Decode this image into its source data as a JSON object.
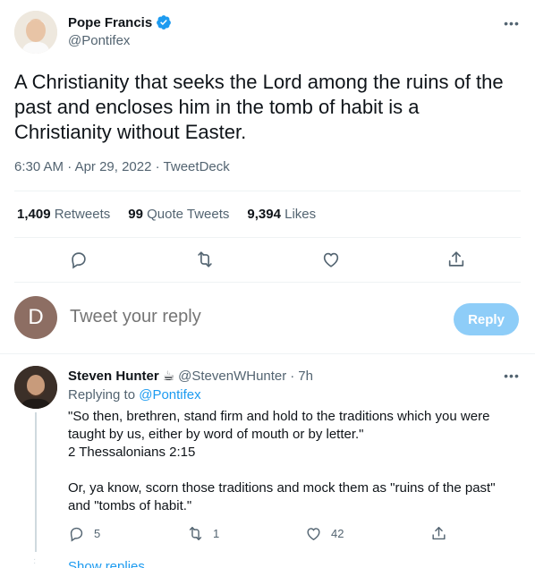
{
  "tweet": {
    "author_name": "Pope Francis",
    "author_handle": "@Pontifex",
    "text": "A Christianity that seeks the Lord among the ruins of the past and encloses him in the tomb of habit is a Christianity without Easter.",
    "time": "6:30 AM",
    "date": "Apr 29, 2022",
    "source": "TweetDeck",
    "retweets_count": "1,409",
    "retweets_label": "Retweets",
    "quotes_count": "99",
    "quotes_label": "Quote Tweets",
    "likes_count": "9,394",
    "likes_label": "Likes"
  },
  "compose": {
    "avatar_letter": "D",
    "placeholder": "Tweet your reply",
    "button_label": "Reply"
  },
  "reply": {
    "author_name": "Steven Hunter",
    "emoji": "☕",
    "author_handle": "@StevenWHunter",
    "time_ago": "7h",
    "replying_label": "Replying to",
    "replying_to": "@Pontifex",
    "text": "\"So then, brethren, stand firm and hold to the traditions which you were taught by us, either by word of mouth or by letter.\"\n2 Thessalonians 2:15\n\nOr, ya know, scorn those traditions and mock them as \"ruins of the past\" and \"tombs of habit.\"",
    "reply_count": "5",
    "retweet_count": "1",
    "like_count": "42"
  },
  "show_replies_label": "Show replies",
  "colors": {
    "accent": "#1d9bf0",
    "muted": "#536471",
    "reply_button": "#8ecdf8",
    "compose_avatar": "#8d6e63"
  },
  "icons": [
    "verified-badge-icon",
    "more-icon",
    "reply-icon",
    "retweet-icon",
    "like-icon",
    "share-icon"
  ]
}
